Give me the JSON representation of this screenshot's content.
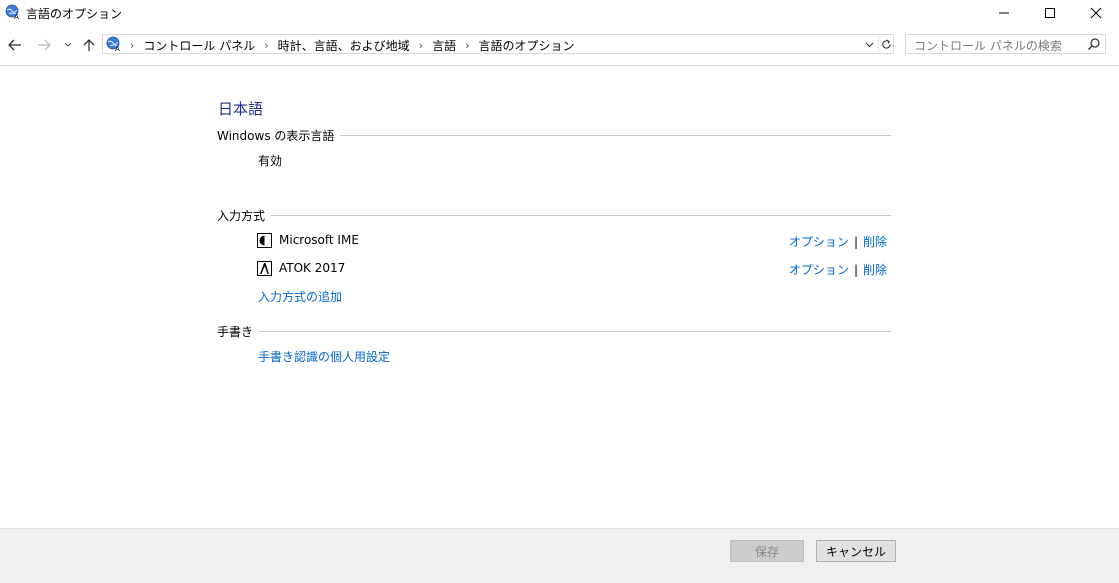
{
  "window": {
    "title": "言語のオプション",
    "app_icon": "globe-language-icon",
    "controls": {
      "minimize_icon": "minimize-icon",
      "maximize_icon": "maximize-icon",
      "close_icon": "close-icon"
    }
  },
  "nav": {
    "back_icon": "back-arrow-icon",
    "forward_icon": "forward-arrow-icon",
    "recent_icon": "chevron-down-icon",
    "up_icon": "up-arrow-icon",
    "breadcrumbs": [
      "コントロール パネル",
      "時計、言語、および地域",
      "言語",
      "言語のオプション"
    ],
    "search_placeholder": "コントロール パネルの検索"
  },
  "content": {
    "language_title": "日本語",
    "display_language": {
      "header": "Windows の表示言語",
      "status": "有効"
    },
    "input_methods": {
      "header": "入力方式",
      "items": [
        {
          "name": "Microsoft IME",
          "icon": "microsoft-ime-icon",
          "options_label": "オプション",
          "remove_label": "削除"
        },
        {
          "name": "ATOK 2017",
          "icon": "atok-icon",
          "options_label": "オプション",
          "remove_label": "削除"
        }
      ],
      "add_label": "入力方式の追加"
    },
    "handwriting": {
      "header": "手書き",
      "personalize_label": "手書き認識の個人用設定"
    }
  },
  "footer": {
    "save_label": "保存",
    "save_enabled": false,
    "cancel_label": "キャンセル"
  },
  "colors": {
    "link": "#0066cc",
    "title_blue": "#1e3287",
    "footer_bg": "#f0f0f0"
  }
}
